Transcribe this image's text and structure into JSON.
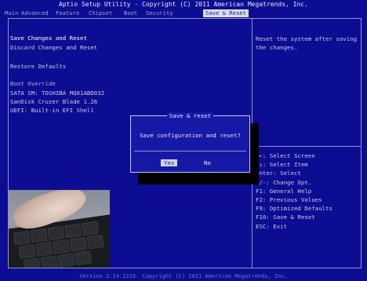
{
  "header": {
    "title": "Aptio Setup Utility - Copyright (C) 2011 American Megatrends, Inc.",
    "tabs": [
      "Main",
      "Advanced",
      "Feature",
      "Chipset",
      "Boot",
      "Security",
      "Save & Reset"
    ],
    "active_tab": "Save & Reset"
  },
  "left": {
    "save_changes_reset": "Save Changes and Reset",
    "discard_changes_reset": "Discard Changes and Reset",
    "restore_defaults": "Restore Defaults",
    "boot_override": "Boot Override",
    "boot_devices": [
      "SATA  SM: TOSHIBA MQ01ABD032",
      "SanDisk Cruzer Blade 1.26",
      "UEFI: Built-in EFI Shell"
    ]
  },
  "help": {
    "text": "Reset the system after saving the changes."
  },
  "keys": [
    "→←: Select Screen",
    "↑↓: Select Item",
    "Enter: Select",
    "+/-: Change Opt.",
    "F1: General Help",
    "F2: Previous Values",
    "F9: Optimized Defaults",
    "F10: Save & Reset",
    "ESC: Exit"
  ],
  "dialog": {
    "title": "Save & reset",
    "question": "Save configuration and reset?",
    "yes": "Yes",
    "no": "No"
  },
  "footer": "Version 2.14.1219. Copyright (C) 2011 American Megatrends, Inc.",
  "colors": {
    "background": "#0c0d92",
    "dialog": "#1618a6",
    "highlight": "#d0d2de"
  }
}
